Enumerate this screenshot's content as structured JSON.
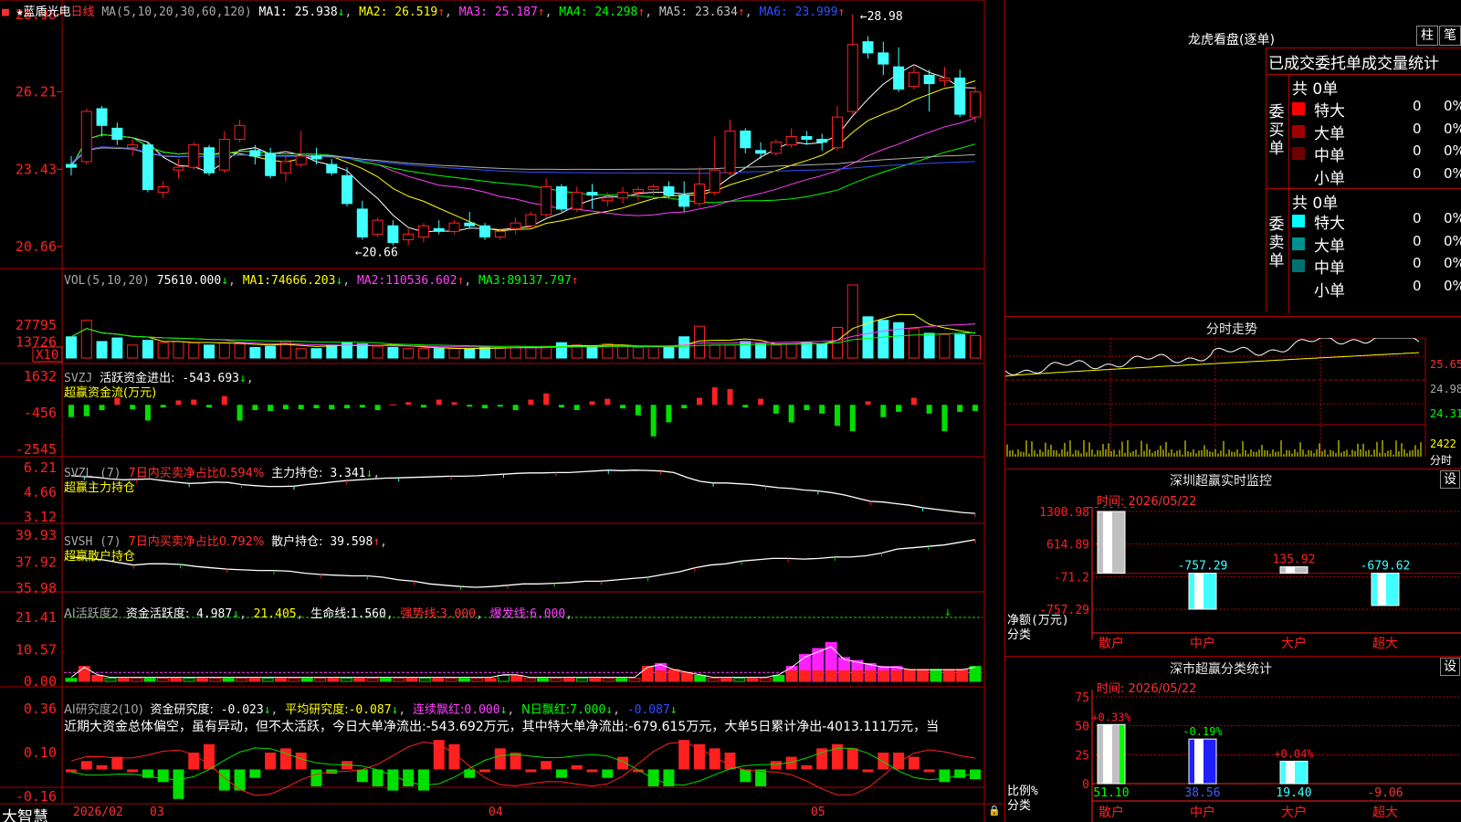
{
  "logo": "大智慧",
  "header": {
    "star": "★",
    "name": "蓝盾光电",
    "period": "日线",
    "ma_params": "MA(5,10,20,30,60,120)",
    "ma": [
      {
        "label": "MA1:",
        "value": "25.938",
        "arrow": "↓",
        "color": "#ffffff"
      },
      {
        "label": "MA2:",
        "value": "26.519",
        "arrow": "↑",
        "color": "#ffff00"
      },
      {
        "label": "MA3:",
        "value": "25.187",
        "arrow": "↑",
        "color": "#ff40ff"
      },
      {
        "label": "MA4:",
        "value": "24.298",
        "arrow": "↑",
        "color": "#00ff00"
      },
      {
        "label": "MA5:",
        "value": "23.634",
        "arrow": "↑",
        "color": "#c0c0c0"
      },
      {
        "label": "MA6:",
        "value": "23.999",
        "arrow": "↑",
        "color": "#3050ff"
      }
    ]
  },
  "price_axis": [
    "28.98",
    "26.21",
    "23.43",
    "20.66"
  ],
  "price_marks": {
    "high": "28.98",
    "low": "20.66"
  },
  "vol": {
    "header": "VOL(5,10,20)",
    "value": "75610.000",
    "arrow": "↓",
    "ma": [
      {
        "label": "MA1:",
        "value": "74666.203",
        "arrow": "↓"
      },
      {
        "label": "MA2:",
        "value": "110536.602",
        "arrow": "↑"
      },
      {
        "label": "MA3:",
        "value": "89137.797",
        "arrow": "↑"
      }
    ],
    "axis": [
      "27795",
      "13726"
    ],
    "unit": "X10"
  },
  "svzj": {
    "header": "SVZJ",
    "title": "活跃资金进出:",
    "value": "-543.693",
    "arrow": "↓",
    "sub": "超赢资金流(万元)",
    "axis": [
      "1632",
      "-456",
      "-2545"
    ]
  },
  "svzl": {
    "header": "SVZL (7)",
    "ratio_label": "7日内买卖净占比0.594%",
    "hold_label": "主力持仓:",
    "hold": "3.341",
    "arrow": "↓",
    "sub": "超赢主力持仓",
    "axis": [
      "6.21",
      "4.66",
      "3.12"
    ]
  },
  "svsh": {
    "header": "SVSH (7)",
    "ratio_label": "7日内买卖净占比0.792%",
    "hold_label": "散户持仓:",
    "hold": "39.598",
    "arrow": "↑",
    "sub": "超赢散户持仓",
    "axis": [
      "39.93",
      "37.92",
      "35.98"
    ]
  },
  "ai2": {
    "header": "AI活跃度2",
    "label": "资金活跃度:",
    "value": "4.987",
    "arrow": "↓",
    "v2": "21.405",
    "label3": "生命线:",
    "value3": "1.560",
    "label4": "强势线:",
    "value4": "3.000",
    "label5": "爆发线:",
    "value5": "6.000",
    "axis": [
      "21.41",
      "10.57",
      "0.00"
    ]
  },
  "ai3": {
    "header": "AI研究度2(10)",
    "label": "资金研究度:",
    "value": "-0.023",
    "arrow": "↓",
    "label2": "平均研究度:",
    "value2": "-0.087",
    "label3": "连续飘红:",
    "value3": "0.000",
    "label4": "N日飘红:",
    "value4": "7.000",
    "value5": "-0.087",
    "comment": "近期大资金总体偏空，虽有异动，但不太活跃，今日大单净流出:-543.692万元，其中特大单净流出:-679.615万元，大单5日累计净出-4013.111万元，当",
    "axis": [
      "0.36",
      "0.10",
      "-0.16"
    ]
  },
  "dates": [
    "2026/02",
    "03",
    "04",
    "05"
  ],
  "lhb": {
    "title": "龙虎看盘(逐单)",
    "btn1": "柱",
    "btn2": "笔",
    "head": "已成交委托单成交量统计",
    "buy": {
      "side": "委买单",
      "total": "共 0单",
      "rows": [
        {
          "name": "特大",
          "v": "0",
          "p": "0%",
          "color": "#ff0000"
        },
        {
          "name": "大单",
          "v": "0",
          "p": "0%",
          "color": "#a00000"
        },
        {
          "name": "中单",
          "v": "0",
          "p": "0%",
          "color": "#700000"
        },
        {
          "name": "小单",
          "v": "0",
          "p": "0%",
          "color": "#000000"
        }
      ]
    },
    "sell": {
      "side": "委卖单",
      "total": "共 0单",
      "rows": [
        {
          "name": "特大",
          "v": "0",
          "p": "0%",
          "color": "#00ffff"
        },
        {
          "name": "大单",
          "v": "0",
          "p": "0%",
          "color": "#009090"
        },
        {
          "name": "中单",
          "v": "0",
          "p": "0%",
          "color": "#007070"
        },
        {
          "name": "小单",
          "v": "0",
          "p": "0%",
          "color": "#000000"
        }
      ]
    }
  },
  "fs": {
    "title": "分时走势",
    "axis": [
      "25.65",
      "24.98",
      "24.31"
    ],
    "vol": "2422",
    "vol_label": "分时"
  },
  "szjk": {
    "title": "深圳超赢实时监控",
    "btn": "设",
    "time": "时间: 2026/05/22",
    "axis": [
      "1300.98",
      "614.89",
      "-71.2",
      "-757.29"
    ],
    "unit": "净额(万元)",
    "cat_label": "分类",
    "cats": [
      "散户",
      "中户",
      "大户",
      "超大"
    ],
    "values": [
      1300.98,
      -757.29,
      135.92,
      -679.62
    ],
    "value_labels": [
      "1300.98",
      "-757.29",
      "135.92",
      "-679.62"
    ]
  },
  "fltj": {
    "title": "深市超赢分类统计",
    "btn": "设",
    "time": "时间: 2026/05/22",
    "axis": [
      "75",
      "50",
      "25",
      "0"
    ],
    "unit": "比例%",
    "cat_label": "分类",
    "cats": [
      "散户",
      "中户",
      "大户",
      "超大"
    ],
    "values": [
      51.1,
      38.56,
      19.4,
      -9.06
    ],
    "value_labels": [
      "51.10",
      "38.56",
      "19.40",
      "-9.06"
    ],
    "changes": [
      "+0.33%",
      "-0.19%",
      "+0.04%"
    ]
  },
  "chart_data": [
    {
      "type": "candlestick",
      "title": "蓝盾光电 日线",
      "ylim": [
        20.0,
        29.3
      ],
      "ohlc": [
        [
          23.6,
          23.9,
          23.2,
          23.5
        ],
        [
          23.7,
          25.6,
          23.6,
          25.5
        ],
        [
          25.6,
          25.7,
          24.6,
          25.0
        ],
        [
          24.9,
          25.1,
          24.3,
          24.5
        ],
        [
          24.2,
          24.5,
          23.9,
          24.3
        ],
        [
          24.3,
          24.4,
          22.6,
          22.7
        ],
        [
          22.6,
          23.0,
          22.4,
          22.8
        ],
        [
          23.4,
          23.8,
          23.1,
          23.5
        ],
        [
          23.5,
          24.4,
          23.4,
          24.3
        ],
        [
          24.2,
          24.3,
          23.2,
          23.3
        ],
        [
          23.4,
          24.8,
          23.3,
          24.5
        ],
        [
          24.5,
          25.2,
          24.4,
          25.0
        ],
        [
          24.1,
          24.3,
          23.6,
          23.9
        ],
        [
          24.0,
          24.2,
          23.1,
          23.2
        ],
        [
          23.3,
          23.9,
          23.0,
          23.7
        ],
        [
          23.6,
          24.8,
          23.5,
          23.9
        ],
        [
          23.9,
          24.2,
          23.6,
          23.8
        ],
        [
          23.6,
          23.8,
          23.2,
          23.3
        ],
        [
          23.2,
          23.5,
          22.1,
          22.2
        ],
        [
          22.0,
          22.3,
          20.9,
          21.0
        ],
        [
          21.1,
          21.7,
          21.0,
          21.6
        ],
        [
          21.4,
          21.6,
          20.7,
          20.8
        ],
        [
          20.9,
          21.3,
          20.7,
          21.1
        ],
        [
          21.0,
          21.5,
          20.8,
          21.4
        ],
        [
          21.3,
          21.6,
          21.1,
          21.2
        ],
        [
          21.2,
          21.6,
          21.1,
          21.5
        ],
        [
          21.5,
          21.9,
          21.3,
          21.4
        ],
        [
          21.4,
          21.5,
          20.9,
          21.0
        ],
        [
          21.0,
          21.3,
          20.9,
          21.2
        ],
        [
          21.3,
          21.7,
          21.1,
          21.5
        ],
        [
          21.4,
          21.9,
          21.3,
          21.8
        ],
        [
          21.8,
          23.1,
          21.7,
          22.8
        ],
        [
          22.8,
          22.9,
          21.9,
          22.0
        ],
        [
          22.0,
          22.8,
          21.9,
          22.6
        ],
        [
          22.6,
          22.9,
          22.0,
          22.5
        ],
        [
          22.3,
          22.6,
          22.1,
          22.4
        ],
        [
          22.4,
          22.8,
          22.2,
          22.6
        ],
        [
          22.6,
          22.8,
          22.3,
          22.7
        ],
        [
          22.7,
          22.9,
          22.5,
          22.8
        ],
        [
          22.8,
          23.0,
          22.4,
          22.5
        ],
        [
          22.5,
          23.0,
          21.9,
          22.1
        ],
        [
          22.2,
          23.5,
          22.1,
          22.9
        ],
        [
          22.6,
          24.6,
          22.5,
          23.4
        ],
        [
          23.3,
          25.2,
          23.2,
          24.8
        ],
        [
          24.8,
          24.9,
          24.0,
          24.2
        ],
        [
          24.1,
          24.4,
          23.8,
          24.0
        ],
        [
          24.0,
          24.5,
          23.9,
          24.4
        ],
        [
          24.3,
          24.9,
          24.2,
          24.6
        ],
        [
          24.6,
          24.8,
          24.3,
          24.5
        ],
        [
          24.5,
          24.7,
          24.1,
          24.4
        ],
        [
          24.2,
          25.7,
          24.1,
          25.3
        ],
        [
          25.5,
          28.98,
          25.4,
          27.9
        ],
        [
          28.0,
          28.2,
          27.4,
          27.6
        ],
        [
          27.6,
          28.0,
          26.8,
          27.2
        ],
        [
          27.1,
          27.8,
          26.2,
          26.3
        ],
        [
          26.4,
          27.2,
          26.3,
          26.9
        ],
        [
          26.8,
          27.0,
          25.5,
          26.5
        ],
        [
          26.6,
          27.1,
          26.4,
          26.7
        ],
        [
          26.7,
          27.0,
          25.3,
          25.4
        ],
        [
          25.3,
          26.4,
          25.1,
          26.2
        ]
      ]
    },
    {
      "type": "bar",
      "title": "VOL",
      "series": [
        {
          "name": "VOL",
          "values": [
            18000,
            32000,
            14000,
            17000,
            11000,
            15000,
            13000,
            14000,
            13000,
            11000,
            13000,
            12000,
            9000,
            10000,
            14000,
            8000,
            8000,
            11000,
            13000,
            12000,
            10000,
            9000,
            8000,
            8000,
            8000,
            8000,
            8000,
            9000,
            9000,
            10000,
            9000,
            10000,
            13000,
            11000,
            9000,
            12000,
            10000,
            9000,
            10000,
            9000,
            18000,
            27000,
            11000,
            11000,
            14000,
            12000,
            11000,
            12000,
            13000,
            12000,
            26000,
            62000,
            35000,
            32000,
            30000,
            25000,
            21000,
            20000,
            20000,
            19000
          ]
        }
      ]
    },
    {
      "type": "bar",
      "title": "超赢资金流",
      "series": [
        {
          "name": "活跃资金进出",
          "values": [
            -700,
            -650,
            -300,
            400,
            -250,
            -900,
            -150,
            250,
            300,
            -150,
            500,
            -900,
            -300,
            -350,
            -250,
            -250,
            -200,
            -250,
            -200,
            -150,
            -300,
            0,
            150,
            -150,
            300,
            150,
            -100,
            -200,
            -100,
            -300,
            300,
            650,
            -150,
            -300,
            200,
            350,
            -200,
            -600,
            -1800,
            -1000,
            -200,
            400,
            1000,
            900,
            -150,
            350,
            -500,
            -1000,
            -300,
            -500,
            -1200,
            -1500,
            200,
            -700,
            -400,
            400,
            -500,
            -1500,
            -400,
            -350
          ]
        }
      ]
    },
    {
      "type": "line",
      "title": "超赢主力持仓",
      "series": [
        {
          "name": "主力持仓",
          "values": [
            5.7,
            5.65,
            5.6,
            5.5,
            5.45,
            5.48,
            5.5,
            5.4,
            5.3,
            5.22,
            5.25,
            5.3,
            5.28,
            5.15,
            5.08,
            5.03,
            5.03,
            5.05,
            5.15,
            5.22,
            5.32,
            5.4,
            5.45,
            5.5,
            5.55,
            5.57,
            5.6,
            5.62,
            5.65,
            5.67,
            5.67,
            5.7,
            5.75,
            5.8,
            5.85,
            5.88,
            5.88,
            5.9,
            5.9,
            5.95,
            6.0,
            6.05,
            6.02,
            6.05,
            6.03,
            6.0,
            5.9,
            5.6,
            5.35,
            5.25,
            5.25,
            5.2,
            5.15,
            5.05,
            4.95,
            4.9,
            4.8,
            4.75,
            4.65,
            4.5,
            4.3,
            4.1,
            4.05,
            3.95,
            3.85,
            3.7,
            3.6,
            3.5,
            3.4,
            3.341
          ]
        }
      ]
    },
    {
      "type": "line",
      "title": "超赢散户持仓",
      "series": [
        {
          "name": "散户持仓",
          "values": [
            38.3,
            38.2,
            38.1,
            37.9,
            37.7,
            37.8,
            37.8,
            37.75,
            37.6,
            37.5,
            37.4,
            37.35,
            37.3,
            37.3,
            37.25,
            37.1,
            37.0,
            36.95,
            36.9,
            36.9,
            36.8,
            36.6,
            36.5,
            36.3,
            36.2,
            36.1,
            36.05,
            36.1,
            36.2,
            36.3,
            36.3,
            36.35,
            36.4,
            36.5,
            36.5,
            36.6,
            36.7,
            36.8,
            37.0,
            37.2,
            37.5,
            37.7,
            37.8,
            38.0,
            38.1,
            38.2,
            38.2,
            38.15,
            38.2,
            38.3,
            38.3,
            38.4,
            38.6,
            38.9,
            39.0,
            39.1,
            39.2,
            39.4,
            39.598
          ]
        }
      ]
    },
    {
      "type": "bar",
      "title": "AI活跃度2",
      "series": [
        {
          "name": "资金活跃度",
          "values": [
            1,
            5,
            2,
            1,
            1,
            1,
            1,
            1,
            1,
            1,
            1,
            1,
            1,
            1,
            1,
            1,
            1,
            1,
            1,
            1,
            1,
            1,
            1,
            1,
            1,
            1,
            1,
            1,
            1,
            1,
            1,
            1,
            1,
            2,
            2,
            1,
            1,
            1,
            1,
            1,
            1,
            1,
            1,
            1,
            5,
            6,
            4,
            3,
            2,
            1,
            1,
            1,
            1,
            1,
            2,
            5,
            9,
            11,
            13,
            8,
            7,
            6,
            5,
            5,
            4,
            4,
            4,
            4,
            4,
            4.987
          ]
        }
      ]
    },
    {
      "type": "bar",
      "title": "AI研究度2(10)",
      "series": [
        {
          "name": "资金研究度",
          "values": [
            0.0,
            0.02,
            0.01,
            0.03,
            0.0,
            -0.02,
            -0.03,
            -0.07,
            0.04,
            0.06,
            -0.05,
            -0.05,
            -0.02,
            0.04,
            0.05,
            0.04,
            -0.04,
            -0.01,
            0.02,
            -0.03,
            -0.04,
            -0.05,
            -0.04,
            -0.05,
            0.07,
            0.06,
            -0.02,
            0.0,
            0.05,
            0.04,
            0.0,
            0.02,
            -0.02,
            0.01,
            0.0,
            -0.02,
            0.03,
            0.0,
            -0.04,
            -0.04,
            0.07,
            0.06,
            0.05,
            0.04,
            -0.03,
            -0.04,
            0.02,
            0.03,
            0.01,
            0.05,
            0.06,
            0.05,
            0.0,
            0.04,
            0.04,
            0.03,
            0.0,
            -0.03,
            -0.02,
            -0.023
          ]
        }
      ]
    },
    {
      "type": "bar",
      "title": "深圳超赢实时监控",
      "categories": [
        "散户",
        "中户",
        "大户",
        "超大"
      ],
      "values": [
        1300.98,
        -757.29,
        135.92,
        -679.62
      ],
      "ylabel": "净额(万元)"
    },
    {
      "type": "bar",
      "title": "深市超赢分类统计",
      "categories": [
        "散户",
        "中户",
        "大户",
        "超大"
      ],
      "values": [
        51.1,
        38.56,
        19.4,
        -9.06
      ],
      "ylabel": "比例%",
      "ylim": [
        0,
        75
      ]
    }
  ]
}
